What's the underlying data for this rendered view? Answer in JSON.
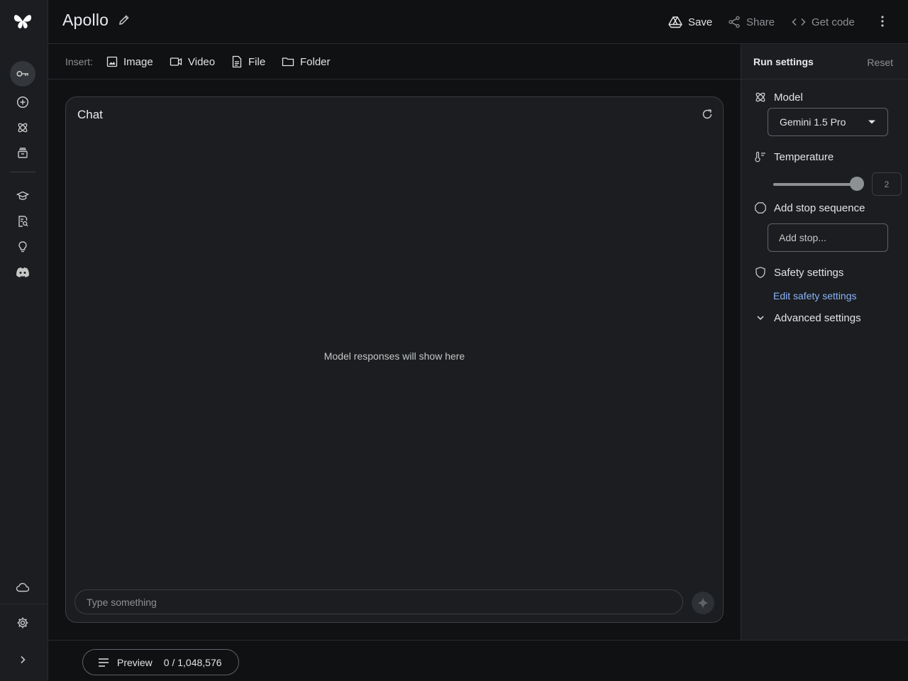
{
  "header": {
    "title": "Apollo",
    "save_label": "Save",
    "share_label": "Share",
    "code_label": "Get code"
  },
  "toolbar": {
    "insert_label": "Insert:",
    "items": [
      {
        "label": "Image",
        "icon": "image-icon"
      },
      {
        "label": "Video",
        "icon": "video-icon"
      },
      {
        "label": "File",
        "icon": "file-icon"
      },
      {
        "label": "Folder",
        "icon": "folder-icon"
      }
    ]
  },
  "chat": {
    "title": "Chat",
    "empty_message": "Model responses will show here",
    "input_placeholder": "Type something"
  },
  "settings": {
    "title": "Run settings",
    "reset_label": "Reset",
    "model_label": "Model",
    "model_value": "Gemini 1.5 Pro",
    "temperature_label": "Temperature",
    "temperature_value": "2",
    "temperature_max": 2,
    "stop_label": "Add stop sequence",
    "stop_placeholder": "Add stop...",
    "safety_label": "Safety settings",
    "safety_link": "Edit safety settings",
    "advanced_label": "Advanced settings"
  },
  "bottom": {
    "preview_label": "Preview",
    "token_count": "0 / 1,048,576"
  },
  "colors": {
    "background": "#0f1113",
    "panel": "#1b1d20",
    "link": "#8ab4f8"
  }
}
